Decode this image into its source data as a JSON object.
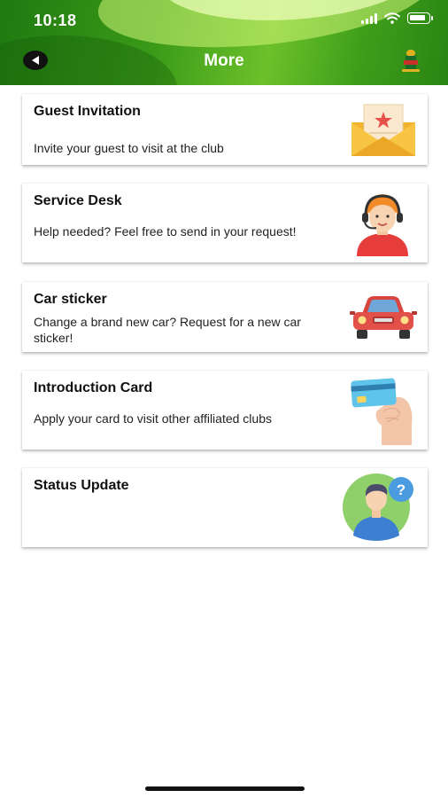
{
  "status_bar": {
    "time": "10:18"
  },
  "header": {
    "title": "More"
  },
  "cards": [
    {
      "title": "Guest Invitation",
      "description": "Invite your guest to visit at the club",
      "icon": "invitation-envelope-icon"
    },
    {
      "title": "Service Desk",
      "description": "Help needed? Feel free to send in your request!",
      "icon": "support-agent-icon"
    },
    {
      "title": "Car sticker",
      "description": "Change a brand new car? Request for a new car sticker!",
      "icon": "car-icon"
    },
    {
      "title": "Introduction Card",
      "description": "Apply your card to visit other affiliated clubs",
      "icon": "card-in-hand-icon"
    },
    {
      "title": "Status Update",
      "description": "",
      "icon": "user-question-icon"
    }
  ],
  "colors": {
    "header_green": "#3a9a18",
    "accent_green": "#6cc12a",
    "card_bg": "#ffffff"
  }
}
